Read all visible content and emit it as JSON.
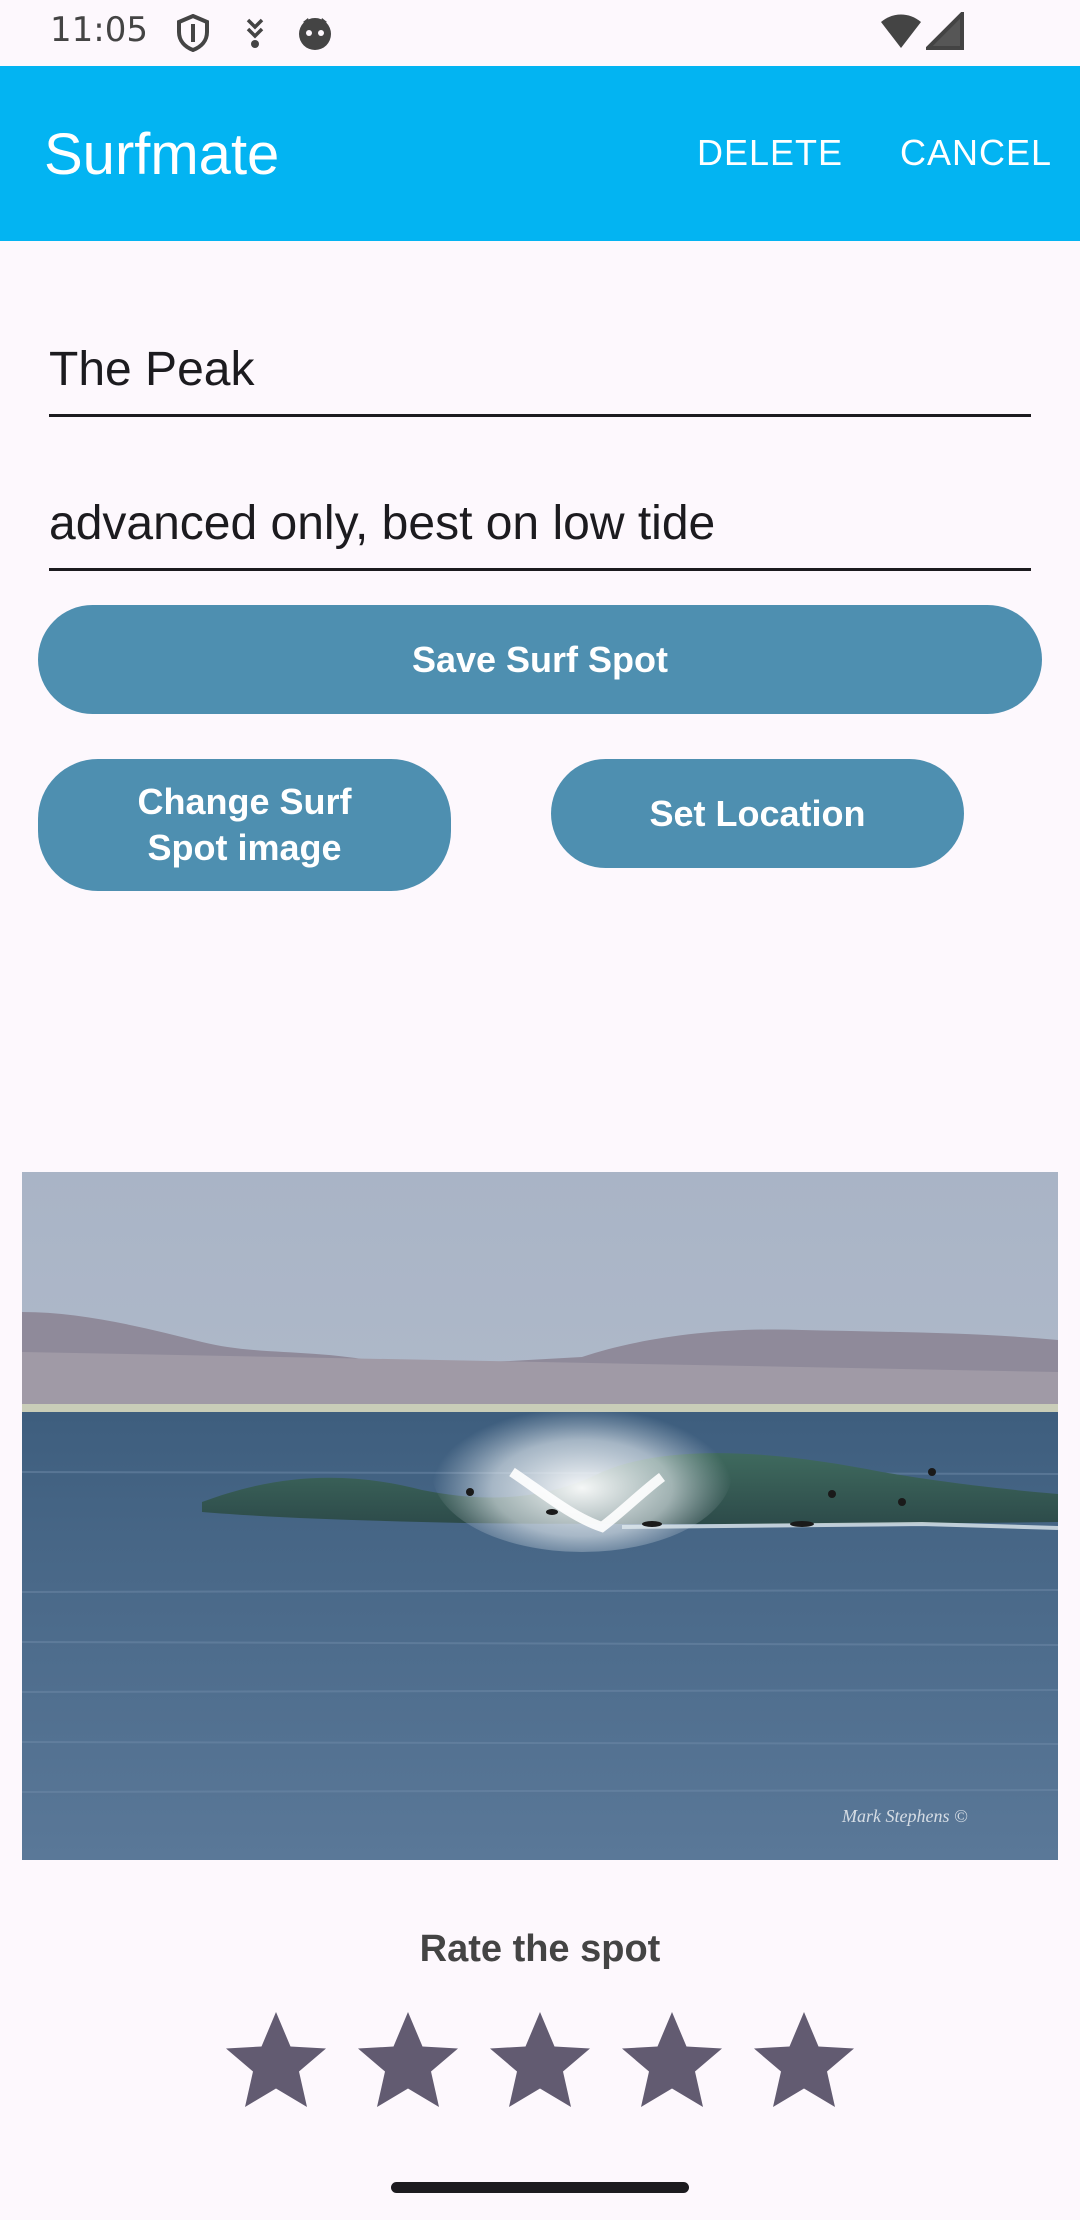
{
  "status": {
    "time": "11:05",
    "icons": [
      "shield-icon",
      "download-icon",
      "cat-icon",
      "wifi-icon",
      "signal-icon"
    ]
  },
  "app_bar": {
    "title": "Surfmate",
    "delete_label": "DELETE",
    "cancel_label": "CANCEL",
    "color": "#03b4f2"
  },
  "form": {
    "name_value": "The Peak",
    "description_value": "advanced only, best on low tide"
  },
  "buttons": {
    "save_label": "Save Surf Spot",
    "change_image_label": "Change Surf Spot image",
    "set_location_label": "Set Location",
    "color": "#4e8fb0"
  },
  "image": {
    "watermark": "Mark Stephens ©"
  },
  "rating": {
    "label": "Rate the spot",
    "value": 5,
    "max": 5,
    "star_color": "#625b71"
  }
}
